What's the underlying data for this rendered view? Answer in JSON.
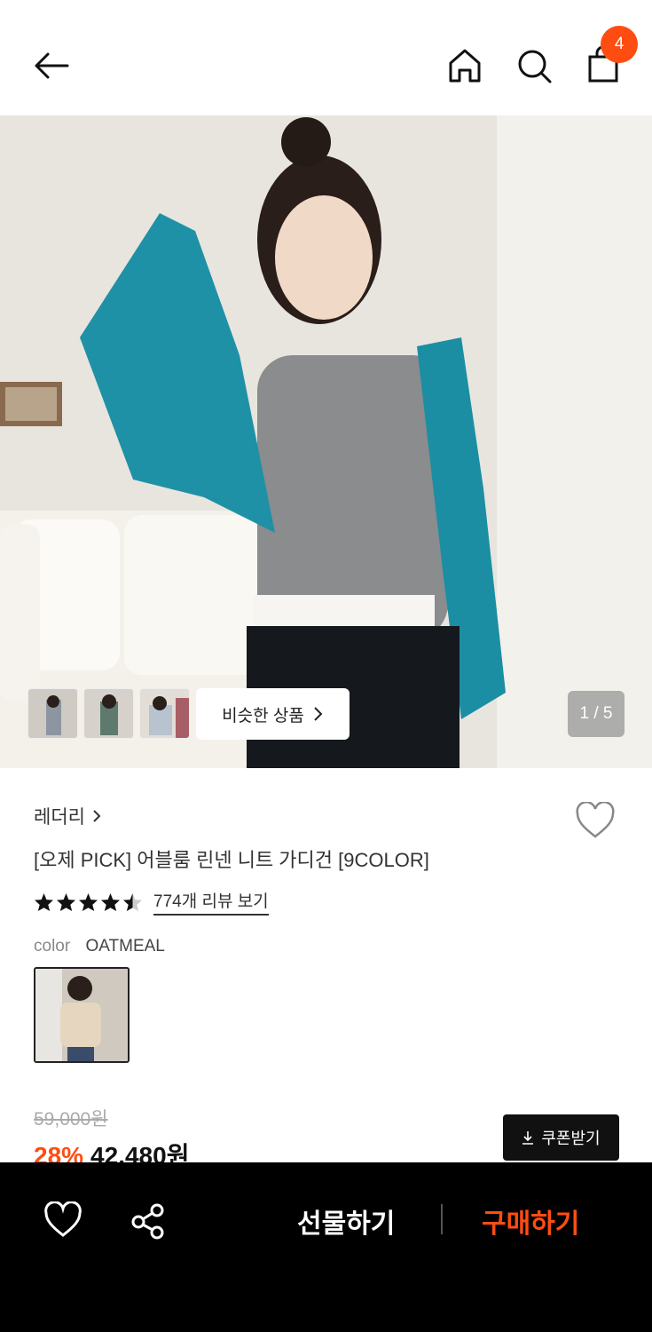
{
  "header": {
    "icons": [
      "back-arrow-icon",
      "home-icon",
      "search-icon",
      "shopping-bag-icon"
    ],
    "cart_count": "4"
  },
  "hero": {
    "similar_products_label": "비슷한 상품",
    "pager": "1 / 5",
    "thumbnail_count": 3
  },
  "product": {
    "brand": "레더리",
    "title": "[오제 PICK] 어블룸 린넨 니트 가디건 [9COLOR]",
    "rating_stars": 4.5,
    "review_link": "774개 리뷰 보기",
    "color_label": "color",
    "color_value": "OATMEAL",
    "original_price": "59,000원",
    "discount": "28%",
    "sale_price": "42,480원",
    "coupon_label": "쿠폰받기"
  },
  "bottom_bar": {
    "gift_label": "선물하기",
    "buy_label": "구매하기"
  },
  "colors": {
    "accent": "#ff4d12",
    "bar_bg": "#000000",
    "text": "#222222"
  }
}
